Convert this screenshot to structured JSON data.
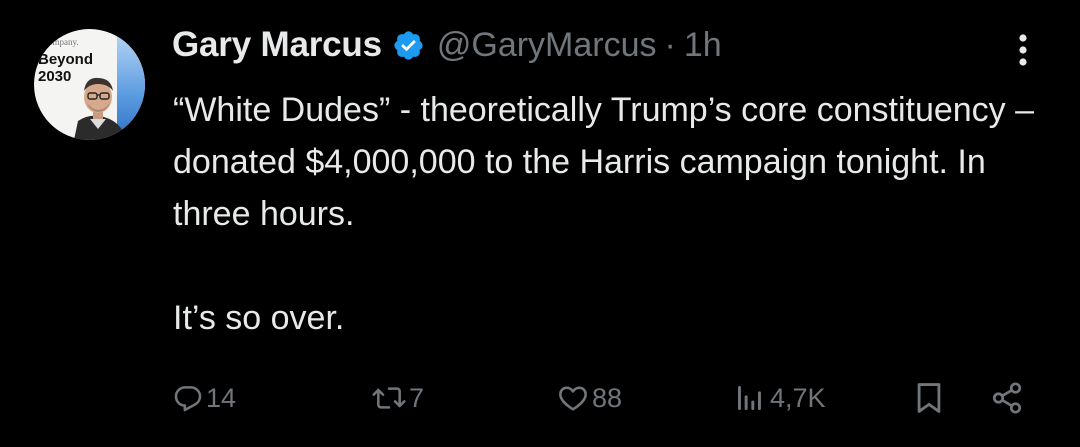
{
  "author": {
    "name": "Gary Marcus",
    "handle": "@GaryMarcus",
    "separator": "·",
    "time": "1h",
    "verified": true,
    "avatar_text": {
      "top": "ompany.",
      "title": "Beyond\n2030"
    }
  },
  "tweet": {
    "paragraphs": [
      "“White Dudes” - theoretically Trump’s core constituency – donated $4,000,000 to the Harris campaign tonight.  In three hours.",
      "It’s so over."
    ]
  },
  "actions": {
    "replies": "14",
    "reposts": "7",
    "likes": "88",
    "views": "4,7K"
  },
  "colors": {
    "background": "#000000",
    "text": "#e7e9ea",
    "muted": "#71767b",
    "verified_badge": "#1d9bf0"
  },
  "icons": {
    "verified": "verified-badge-icon",
    "more": "more-vertical-icon",
    "reply": "reply-icon",
    "repost": "repost-icon",
    "like": "heart-icon",
    "views": "views-chart-icon",
    "bookmark": "bookmark-icon",
    "share": "share-icon"
  }
}
